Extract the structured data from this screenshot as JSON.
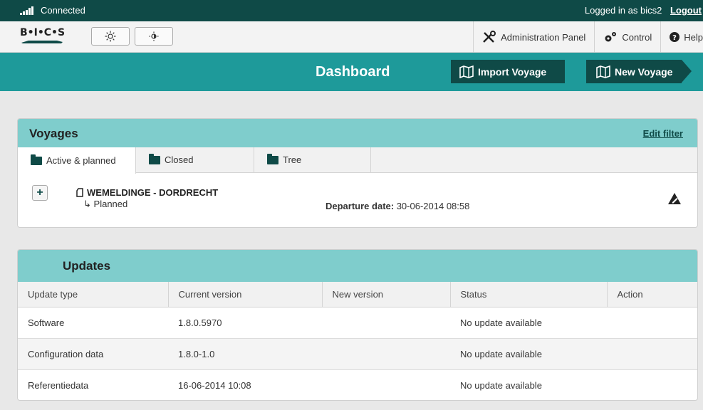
{
  "status_bar": {
    "connection": "Connected",
    "logged_in": "Logged in as bics2",
    "logout": "Logout"
  },
  "toolbar": {
    "logo_text": "B•I•C•S",
    "admin_panel": "Administration Panel",
    "control": "Control",
    "help": "Help"
  },
  "dashboard": {
    "title": "Dashboard",
    "import_voyage": "Import Voyage",
    "new_voyage": "New Voyage"
  },
  "voyages": {
    "title": "Voyages",
    "edit_filter": "Edit filter",
    "tabs": [
      {
        "label": "Active & planned",
        "active": true
      },
      {
        "label": "Closed",
        "active": false
      },
      {
        "label": "Tree",
        "active": false
      }
    ],
    "items": [
      {
        "name": "WEMELDINGE - DORDRECHT",
        "status": "Planned",
        "departure_label": "Departure date:",
        "departure_value": "30-06-2014 08:58"
      }
    ]
  },
  "updates": {
    "title": "Updates",
    "columns": [
      "Update type",
      "Current version",
      "New version",
      "Status",
      "Action"
    ],
    "rows": [
      {
        "type": "Software",
        "current": "1.8.0.5970",
        "new": "",
        "status": "No update available",
        "action": ""
      },
      {
        "type": "Configuration data",
        "current": "1.8.0-1.0",
        "new": "",
        "status": "No update available",
        "action": ""
      },
      {
        "type": "Referentiedata",
        "current": "16-06-2014 10:08",
        "new": "",
        "status": "No update available",
        "action": ""
      }
    ]
  },
  "colors": {
    "dark_teal": "#0f4a47",
    "teal": "#1e9a9a",
    "light_teal": "#7fcdcc"
  }
}
